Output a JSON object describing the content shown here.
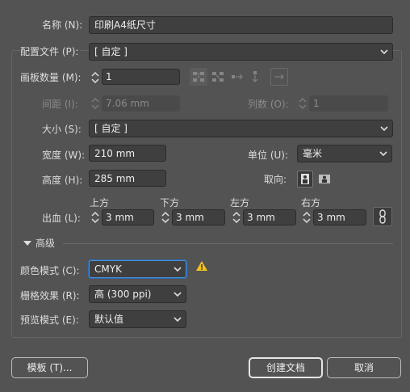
{
  "name": {
    "label": "名称 (N):",
    "value": "印刷A4纸尺寸"
  },
  "profile": {
    "label": "配置文件 (P):",
    "value": "[ 自定 ]"
  },
  "artboards": {
    "label": "画板数量 (M):",
    "value": "1"
  },
  "spacing": {
    "label": "间距 (I):",
    "value": "7.06 mm"
  },
  "columns": {
    "label": "列数 (O):",
    "value": "1"
  },
  "size": {
    "label": "大小 (S):",
    "value": "[ 自定 ]"
  },
  "width": {
    "label": "宽度 (W):",
    "value": "210 mm"
  },
  "units": {
    "label": "单位 (U):",
    "value": "毫米"
  },
  "height": {
    "label": "高度 (H):",
    "value": "285 mm"
  },
  "orientation": {
    "label": "取向:"
  },
  "bleed": {
    "label": "出血 (L):",
    "top": {
      "label": "上方",
      "value": "3 mm"
    },
    "bottom": {
      "label": "下方",
      "value": "3 mm"
    },
    "left": {
      "label": "左方",
      "value": "3 mm"
    },
    "right": {
      "label": "右方",
      "value": "3 mm"
    }
  },
  "advanced": {
    "label": "高级"
  },
  "color_mode": {
    "label": "颜色模式 (C):",
    "value": "CMYK"
  },
  "raster_effects": {
    "label": "栅格效果 (R):",
    "value": "高 (300 ppi)"
  },
  "preview_mode": {
    "label": "预览模式 (E):",
    "value": "默认值"
  },
  "buttons": {
    "templates": "模板 (T)...",
    "create": "创建文档",
    "cancel": "取消"
  },
  "colors": {
    "background": "#535353",
    "field": "#3f3f3f",
    "warning": "#f2c31b",
    "focus": "#4a90d9"
  }
}
